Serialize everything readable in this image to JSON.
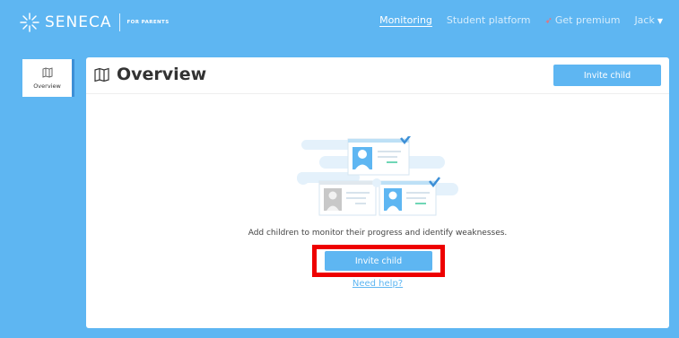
{
  "header": {
    "brand": "SENECA",
    "brand_sub": "FOR PARENTS",
    "nav": {
      "monitoring": "Monitoring",
      "student_platform": "Student platform",
      "get_premium": "Get premium",
      "user": "Jack"
    }
  },
  "sidebar": {
    "overview_label": "Overview"
  },
  "main": {
    "title": "Overview",
    "invite_header_label": "Invite child",
    "empty_message": "Add children to monitor their progress and identify weaknesses.",
    "invite_main_label": "Invite child",
    "help_link": "Need help?"
  },
  "colors": {
    "background": "#5eb6f2",
    "accent": "#5eb6f2",
    "highlight": "#e00000"
  }
}
